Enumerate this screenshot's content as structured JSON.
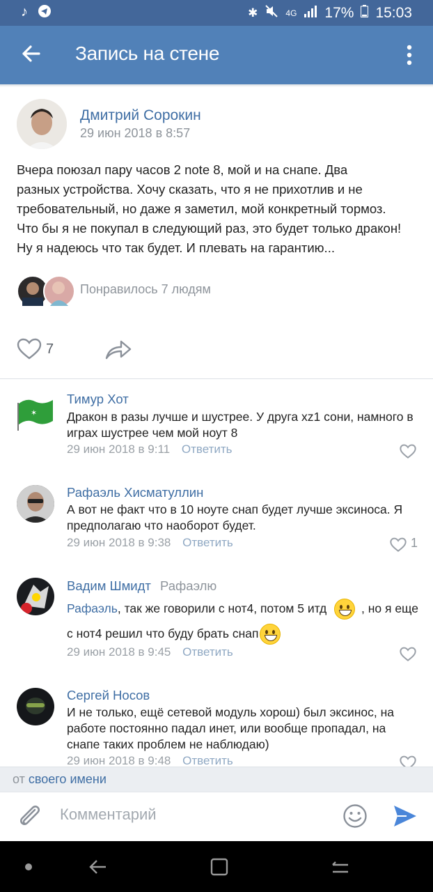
{
  "status": {
    "time": "15:03",
    "battery": "17%",
    "network": "4G"
  },
  "appbar": {
    "title": "Запись на стене"
  },
  "post": {
    "author": "Дмитрий Сорокин",
    "date": "29 июн 2018 в 8:57",
    "text_lines": [
      "Вчера поюзал пару часов 2 note 8, мой и на снапе. Два",
      "разных устройства. Хочу сказать, что я не прихотлив и не",
      "требовательный, но даже я заметил, мой конкретный тормоз.",
      "Что бы я не покупал в следующий раз, это будет только дракон!",
      "Ну я надеюсь что так будет. И плевать на гарантию..."
    ],
    "likes_text": "Понравилось 7 людям",
    "like_count": "7"
  },
  "comments": [
    {
      "author": "Тимур Хот",
      "text_lines": [
        "Дракон в разы лучше и шустрее. У друга xz1 сони, намного в",
        "играх шустрее чем мой ноут 8"
      ],
      "date": "29 июн 2018 в 9:11",
      "reply": "Ответить",
      "likes": ""
    },
    {
      "author": "Рафаэль Хисматуллин",
      "text_lines": [
        "А вот не факт что в 10 ноуте снап будет лучше эксиноса. Я",
        "предполагаю что наоборот будет."
      ],
      "date": "29 июн 2018 в 9:38",
      "reply": "Ответить",
      "likes": "1"
    },
    {
      "author": "Вадим Шмидт",
      "reply_to": "Рафаэлю",
      "mention": "Рафаэль",
      "text_line1": ", так же говорили с нот4, потом 5 итд",
      "text_line1b": ", но я еще",
      "text_line2": "с нот4 решил что буду брать снап",
      "date": "29 июн 2018 в 9:45",
      "reply": "Ответить",
      "likes": ""
    },
    {
      "author": "Сергей Носов",
      "text_lines": [
        "И не только, ещё сетевой модуль хорош) был эксинос, на",
        "работе постоянно падал инет, или вообще пропадал, на",
        "снапе таких проблем не наблюдаю)"
      ],
      "date": "29 июн 2018 в 9:48",
      "reply": "Ответить",
      "likes": ""
    }
  ],
  "footer": {
    "from_prefix": "от",
    "from_link": "своего имени",
    "placeholder": "Комментарий"
  },
  "colors": {
    "header": "#5181b8",
    "statusbar": "#43679a",
    "link": "#3f6ea4",
    "send": "#4a86d9"
  }
}
